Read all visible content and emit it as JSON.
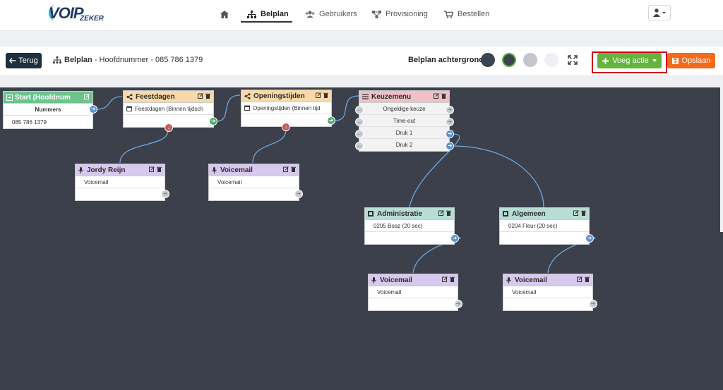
{
  "brand": {
    "logo_main": "VOIP",
    "logo_sub": "ZEKER"
  },
  "nav": {
    "items": [
      {
        "label": "",
        "icon": "home-icon"
      },
      {
        "label": "Belplan",
        "icon": "sitemap-icon",
        "active": true
      },
      {
        "label": "Gebruikers",
        "icon": "users-icon"
      },
      {
        "label": "Provisioning",
        "icon": "network-icon"
      },
      {
        "label": "Bestellen",
        "icon": "cart-icon"
      }
    ],
    "user_icon": "user-icon"
  },
  "toolbar": {
    "back_label": "Terug",
    "crumb_title": "Belplan",
    "crumb_sep": " - ",
    "crumb_subtitle": "Hoofdnummer - 085 786 1379",
    "background_label": "Belplan achtergrond",
    "swatches": [
      "#3a4552",
      "#3a4552",
      "#c3c6ca",
      "#eef0f3"
    ],
    "add_action_label": "Voeg actie",
    "save_label": "Opslaan"
  },
  "colors": {
    "canvas": "#3b404b",
    "add_button": "#63b33d",
    "save_button": "#f26a1b",
    "highlight": "#d0021b"
  },
  "nodes": {
    "start": {
      "title": "Start (Hoofdnum",
      "rows": [
        "Nummers",
        "085 786 1379"
      ]
    },
    "feestdagen": {
      "title": "Feestdagen",
      "rows": [
        "Feestdagen (Binnen tijdsch"
      ]
    },
    "openingstijden": {
      "title": "Openingstijden",
      "rows": [
        "Openingstijden (Binnen tijd"
      ]
    },
    "keuzemenu": {
      "title": "Keuzemenu",
      "rows": [
        "Ongeldige keuze",
        "Time-out",
        "Druk 1",
        "Druk 2"
      ]
    },
    "jordy": {
      "title": "Jordy Reijn",
      "rows": [
        "Voicemail"
      ]
    },
    "voicemail1": {
      "title": "Voicemail",
      "rows": [
        "Voicemail"
      ]
    },
    "administratie": {
      "title": "Administratie",
      "rows": [
        "0205 Boaz (20 sec)"
      ]
    },
    "algemeen": {
      "title": "Algemeen",
      "rows": [
        "0204 Fleur (20 sec)"
      ]
    },
    "voicemail2": {
      "title": "Voicemail",
      "rows": [
        "Voicemail"
      ]
    },
    "voicemail3": {
      "title": "Voicemail",
      "rows": [
        "Voicemail"
      ]
    }
  }
}
